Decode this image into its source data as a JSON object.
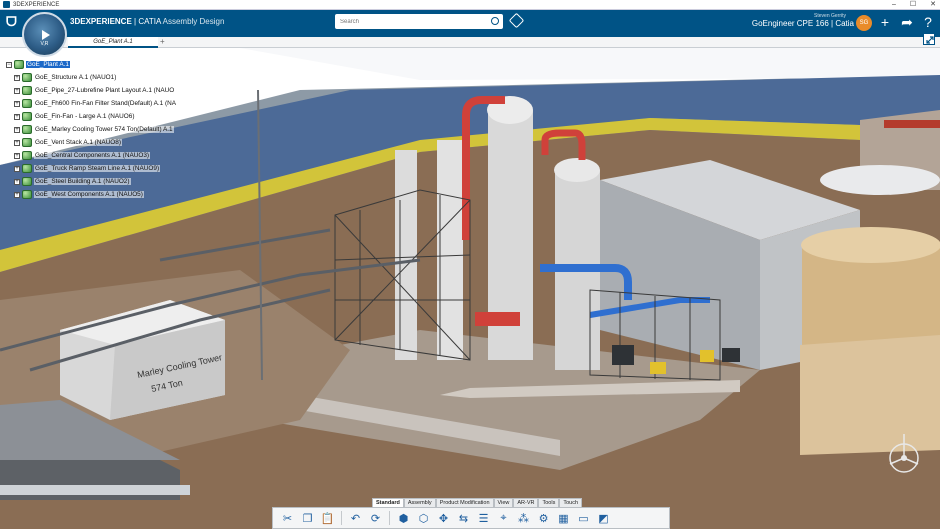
{
  "window": {
    "title": "3DEXPERIENCE",
    "controls": [
      "–",
      "☐",
      "✕"
    ]
  },
  "topbar": {
    "brand_bold": "3DEXPERIENCE",
    "brand_app": " | CATIA",
    "brand_mode": " Assembly Design",
    "compass_label": "V,R",
    "search_placeholder": "Search",
    "user_name": "Steven Gerrity",
    "org": "GoEngineer CPE 166 | Catia",
    "avatar": "SG"
  },
  "tabs": [
    {
      "label": "GoE_Plant A.1"
    }
  ],
  "tree": {
    "root": "GoE_Plant A.1",
    "children": [
      "GoE_Structure A.1 (NAUO1)",
      "GoE_Pipe_27-Lubrefine Plant Layout A.1 (NAUO",
      "GoE_Fh600 Fin-Fan Filter Stand(Default) A.1 (NA",
      "GoE_Fin-Fan - Large A.1 (NAUO6)",
      "GoE_Marley Cooling Tower 574 Ton(Default) A.1",
      "GoE_Vent Stack A.1 (NAUO8)",
      "GoE_Central Components A.1 (NAUO3)",
      "GoE_Truck Ramp Steam Line A.1 (NAUO9)",
      "GoE_Steel Building A.1 (NAUO2)",
      "GoE_West Components A.1 (NAUO5)"
    ]
  },
  "scene": {
    "tower_label_1": "Marley Cooling Tower",
    "tower_label_2": "574 Ton"
  },
  "actionbar": {
    "sections": [
      "Standard",
      "Assembly",
      "Product Modification",
      "View",
      "AR-VR",
      "Tools",
      "Touch"
    ],
    "active_section": "Standard"
  },
  "colors": {
    "brand_blue": "#005386",
    "selection_blue": "#1b68c8",
    "ground": "#8a6d54",
    "wall_yellow": "#d2c43a"
  }
}
